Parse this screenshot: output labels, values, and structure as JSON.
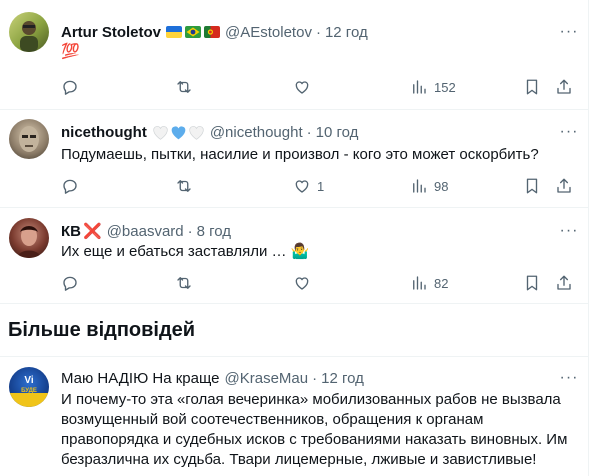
{
  "tweets": [
    {
      "name": "Artur Stoletov",
      "handle": "@AEstoletov",
      "time": "12 год",
      "text": "💯",
      "stats": {
        "views": "152"
      },
      "flags": [
        "ukraine",
        "brazil",
        "portugal"
      ]
    },
    {
      "name": "nicethought",
      "handle": "@nicethought",
      "time": "10 год",
      "text": "Подумаешь, пытки, насилие и произвол - кого это может оскорбить?",
      "stats": {
        "likes": "1",
        "views": "98"
      },
      "hearts": [
        "white",
        "blue",
        "white"
      ]
    },
    {
      "name": "КВ",
      "name_emoji": "❌",
      "handle": "@baasvard",
      "time": "8 год",
      "text": "Их еще и ебаться заставляли … 🤷‍♂️",
      "stats": {
        "views": "82"
      }
    }
  ],
  "section": {
    "title": "Більше відповідей"
  },
  "more_tweet": {
    "name": "Маю НАДІЮ На краще",
    "handle": "@KraseMau",
    "time": "12 год",
    "avatar_text": "Vi БУДЕ",
    "text": "И почему-то эта «голая вечеринка» мобилизованных рабов не вызвала возмущенный вой соотечественников, обращения к органам правопорядка и судебных исков с требованиями наказать виновных. Им безразлична их судьба. Твари лицемерные, лживые и завистливые!"
  },
  "colors": {
    "text": "#0f1419",
    "muted": "#536471",
    "border": "#eff3f4",
    "heart_blue": "#5dadec"
  }
}
